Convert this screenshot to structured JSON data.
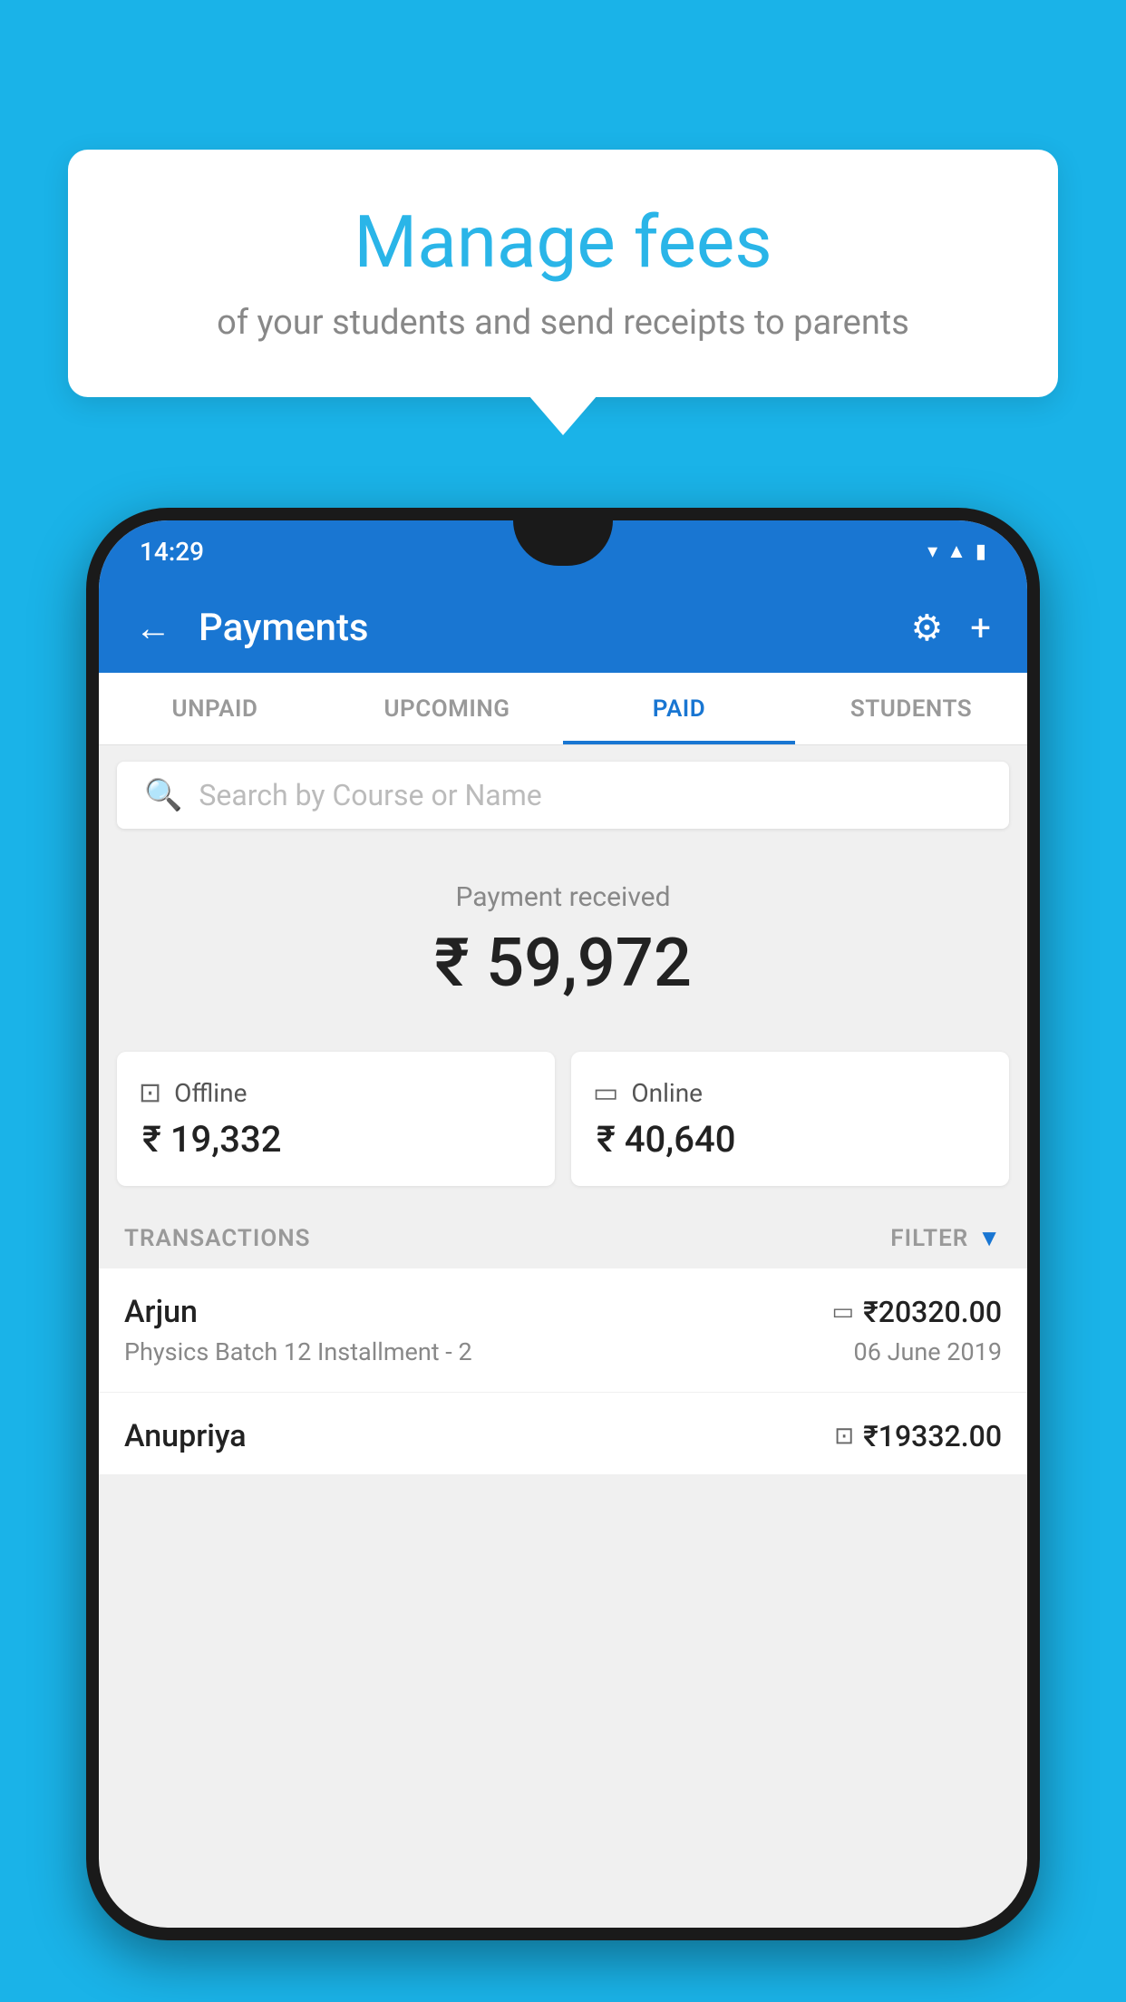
{
  "page": {
    "background_color": "#1ab3e8"
  },
  "speech_bubble": {
    "title": "Manage fees",
    "subtitle": "of your students and send receipts to parents"
  },
  "status_bar": {
    "time": "14:29",
    "wifi_icon": "wifi",
    "signal_icon": "signal",
    "battery_icon": "battery"
  },
  "app_bar": {
    "title": "Payments",
    "back_icon": "←",
    "settings_icon": "⚙",
    "add_icon": "+"
  },
  "tabs": [
    {
      "label": "UNPAID",
      "active": false
    },
    {
      "label": "UPCOMING",
      "active": false
    },
    {
      "label": "PAID",
      "active": true
    },
    {
      "label": "STUDENTS",
      "active": false
    }
  ],
  "search": {
    "placeholder": "Search by Course or Name"
  },
  "payment_section": {
    "label": "Payment received",
    "amount": "₹ 59,972",
    "offline": {
      "label": "Offline",
      "amount": "₹ 19,332"
    },
    "online": {
      "label": "Online",
      "amount": "₹ 40,640"
    }
  },
  "transactions": {
    "header": "TRANSACTIONS",
    "filter": "FILTER",
    "rows": [
      {
        "name": "Arjun",
        "amount": "₹20320.00",
        "course": "Physics Batch 12 Installment - 2",
        "date": "06 June 2019",
        "payment_type": "card"
      },
      {
        "name": "Anupriya",
        "amount": "₹19332.00",
        "course": "",
        "date": "",
        "payment_type": "offline"
      }
    ]
  }
}
